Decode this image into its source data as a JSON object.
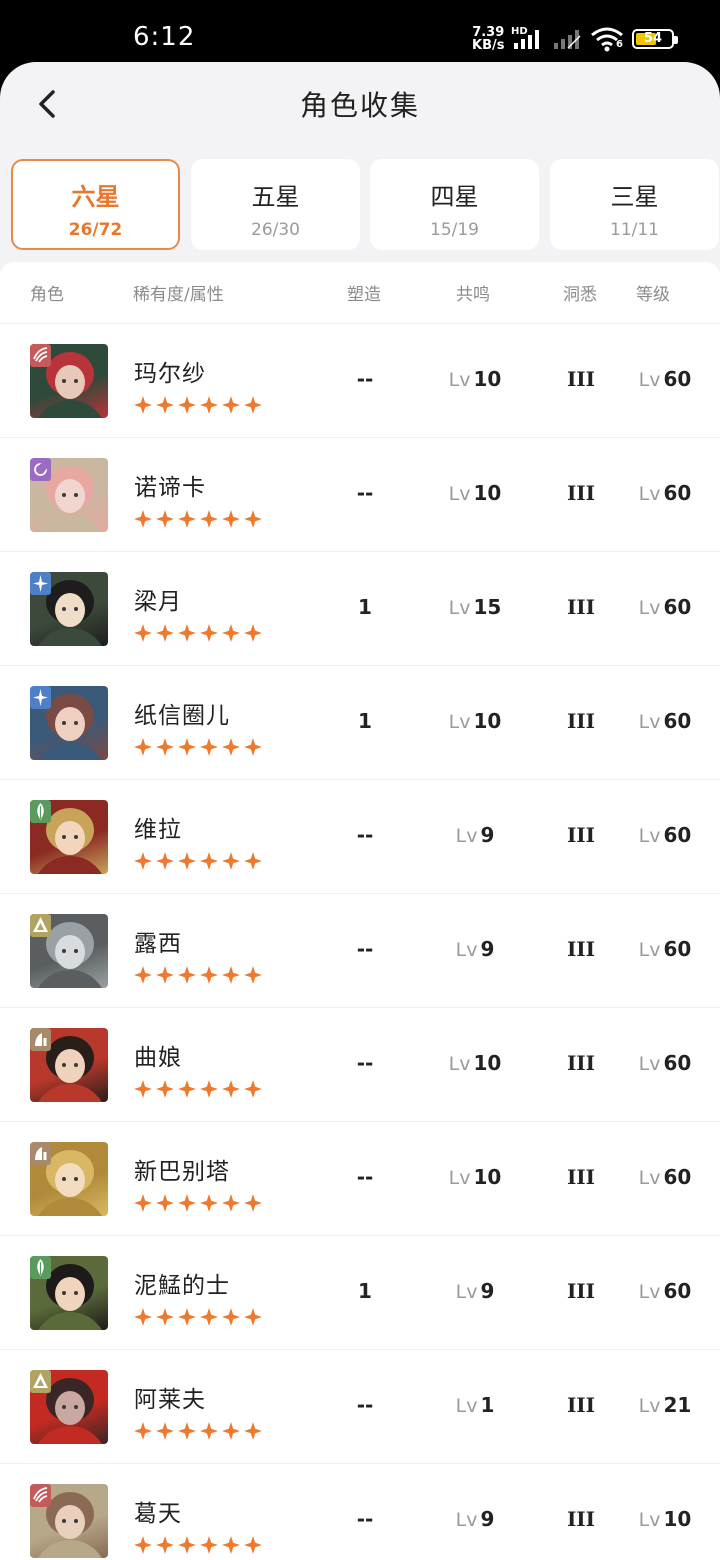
{
  "status_bar": {
    "time": "6:12",
    "net_speed_value": "7.39",
    "net_speed_unit": "KB/s",
    "hd_label": "HD",
    "battery_level": "54",
    "wifi_label": "6"
  },
  "header": {
    "title": "角色收集"
  },
  "tabs": [
    {
      "label": "六星",
      "count": "26/72",
      "active": true
    },
    {
      "label": "五星",
      "count": "26/30",
      "active": false
    },
    {
      "label": "四星",
      "count": "15/19",
      "active": false
    },
    {
      "label": "三星",
      "count": "11/11",
      "active": false
    }
  ],
  "table": {
    "columns": {
      "character": "角色",
      "rarity": "稀有度/属性",
      "mold": "塑造",
      "resonance": "共鸣",
      "insight": "洞悉",
      "level": "等级"
    },
    "lv_prefix": "Lv",
    "rows": [
      {
        "name": "玛尔纱",
        "stars": 6,
        "attr_icon": "beast-icon",
        "attr_color": "#c45a5a",
        "mold": "--",
        "resonance": "10",
        "insight": "III",
        "level": "60"
      },
      {
        "name": "诺谛卡",
        "stars": 6,
        "attr_icon": "star-moon-icon",
        "attr_color": "#9b6bc2",
        "mold": "--",
        "resonance": "10",
        "insight": "III",
        "level": "60"
      },
      {
        "name": "梁月",
        "stars": 6,
        "attr_icon": "spirit-icon",
        "attr_color": "#4f7fc4",
        "mold": "1",
        "resonance": "15",
        "insight": "III",
        "level": "60"
      },
      {
        "name": "纸信圈儿",
        "stars": 6,
        "attr_icon": "spirit-icon",
        "attr_color": "#4f7fc4",
        "mold": "1",
        "resonance": "10",
        "insight": "III",
        "level": "60"
      },
      {
        "name": "维拉",
        "stars": 6,
        "attr_icon": "plant-icon",
        "attr_color": "#5a9a5e",
        "mold": "--",
        "resonance": "9",
        "insight": "III",
        "level": "60"
      },
      {
        "name": "露西",
        "stars": 6,
        "attr_icon": "mineral-icon",
        "attr_color": "#b3a363",
        "mold": "--",
        "resonance": "9",
        "insight": "III",
        "level": "60"
      },
      {
        "name": "曲娘",
        "stars": 6,
        "attr_icon": "intellect-icon",
        "attr_color": "#a88a6a",
        "mold": "--",
        "resonance": "10",
        "insight": "III",
        "level": "60"
      },
      {
        "name": "新巴别塔",
        "stars": 6,
        "attr_icon": "intellect-icon",
        "attr_color": "#a88a6a",
        "mold": "--",
        "resonance": "10",
        "insight": "III",
        "level": "60"
      },
      {
        "name": "泥鯭的士",
        "stars": 6,
        "attr_icon": "plant-icon",
        "attr_color": "#5a9a5e",
        "mold": "1",
        "resonance": "9",
        "insight": "III",
        "level": "60"
      },
      {
        "name": "阿莱夫",
        "stars": 6,
        "attr_icon": "mineral-icon",
        "attr_color": "#b3a363",
        "mold": "--",
        "resonance": "1",
        "insight": "III",
        "level": "21"
      },
      {
        "name": "葛天",
        "stars": 6,
        "attr_icon": "beast-icon",
        "attr_color": "#c45a5a",
        "mold": "--",
        "resonance": "9",
        "insight": "III",
        "level": "10"
      }
    ]
  },
  "colors": {
    "accent": "#e8772e",
    "star": "#ef7a2e",
    "background": "#f3f3f5"
  }
}
